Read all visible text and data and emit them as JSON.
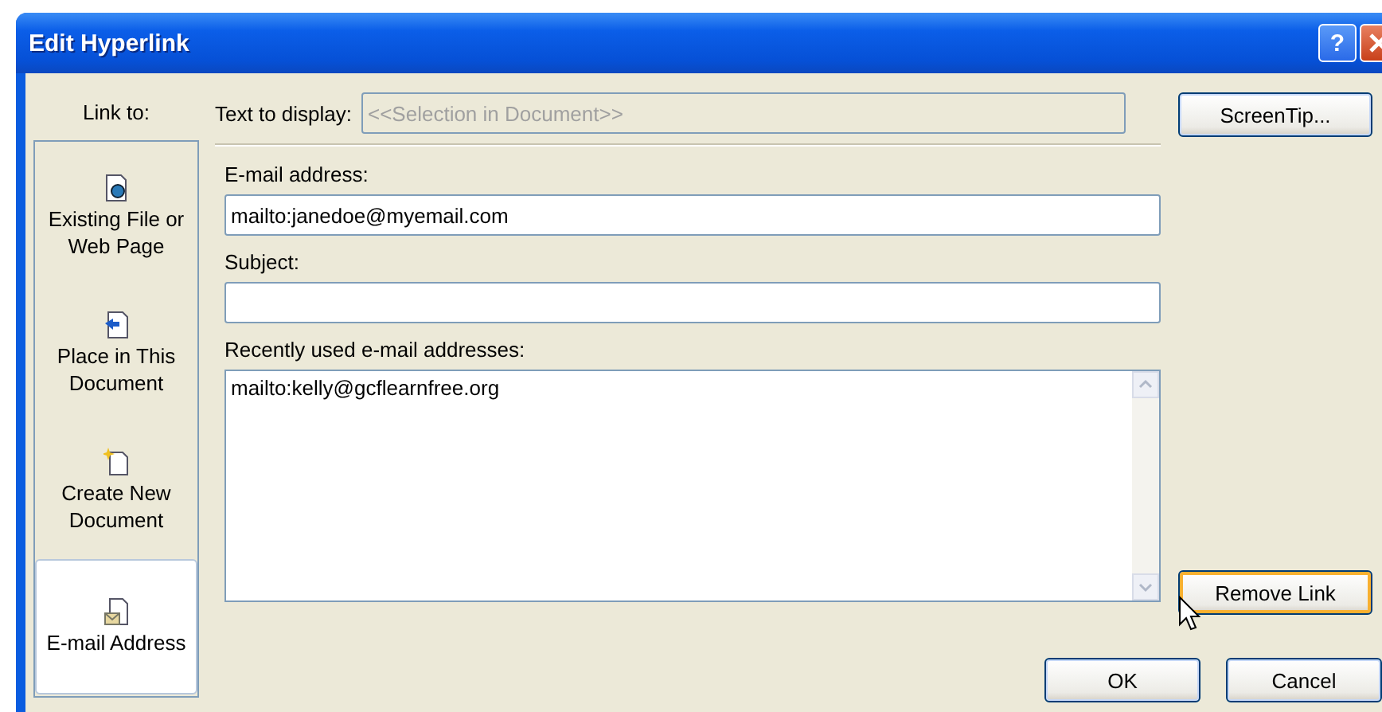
{
  "window": {
    "title": "Edit Hyperlink",
    "controls": [
      {
        "kind": "help",
        "label": "?"
      },
      {
        "kind": "close"
      }
    ]
  },
  "link_to": {
    "label": "Link to:",
    "items": [
      {
        "kind": "file",
        "label": "Existing File or Web Page",
        "selected": false
      },
      {
        "kind": "place",
        "label": "Place in This Document",
        "selected": false
      },
      {
        "kind": "new",
        "label": "Create New Document",
        "selected": false
      },
      {
        "kind": "email",
        "label": "E-mail Address",
        "selected": true
      }
    ]
  },
  "text_to_display": {
    "label": "Text to display:",
    "value": "<<Selection in Document>>",
    "disabled": true
  },
  "email_address": {
    "label": "E-mail address:",
    "value": "mailto:janedoe@myemail.com"
  },
  "subject": {
    "label": "Subject:"
  },
  "recent": {
    "label": "Recently used e-mail addresses:",
    "items": [
      "mailto:kelly@gcflearnfree.org"
    ]
  },
  "buttons": {
    "screentip": "ScreenTip...",
    "remove_link": "Remove Link",
    "ok": "OK",
    "cancel": "Cancel"
  }
}
